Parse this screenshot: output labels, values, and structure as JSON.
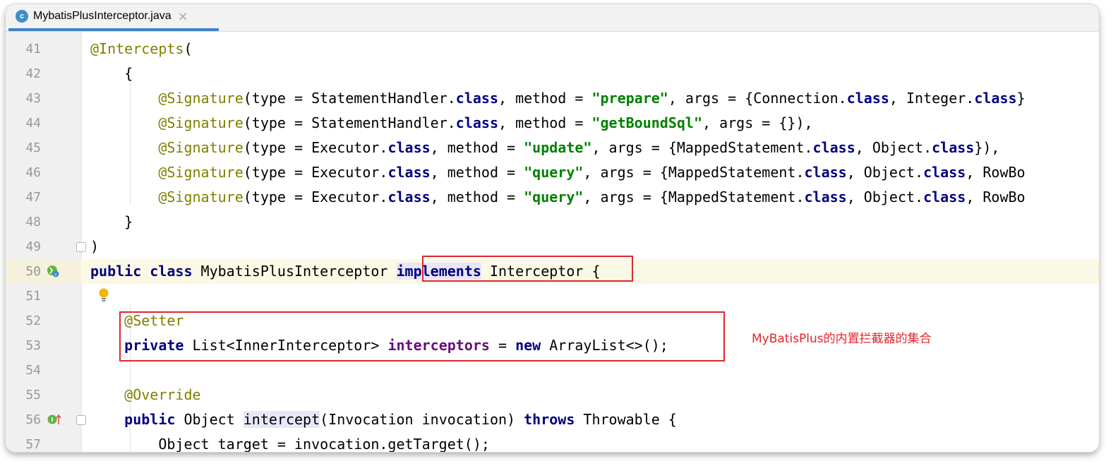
{
  "tab": {
    "icon_letter": "c",
    "filename": "MybatisPlusInterceptor.java",
    "close_glyph": "×"
  },
  "icons": {
    "tab_file": "java-class-icon",
    "line50": "implemented-class-icon",
    "line51": "intention-bulb-icon",
    "line56": "implementing-method-icon",
    "fold": "fold-marker-icon"
  },
  "colors": {
    "keyword": "#000080",
    "string": "#008000",
    "annotation": "#808000",
    "field": "#660e7a",
    "highlight_box": "#e0262c",
    "current_line": "#fcf8e6"
  },
  "lines": [
    {
      "num": "41",
      "a": "@Intercepts",
      "b": "("
    },
    {
      "num": "42",
      "indent": "    ",
      "b": "{"
    },
    {
      "num": "43",
      "indent": "        ",
      "a": "@Signature",
      "p1": "(type = StatementHandler.",
      "k1": "class",
      "p2": ", method = ",
      "s": "\"prepare\"",
      "p3": ", args = {Connection.",
      "k2": "class",
      "p4": ", Integer.",
      "k3": "class",
      "p5": "}"
    },
    {
      "num": "44",
      "indent": "        ",
      "a": "@Signature",
      "p1": "(type = StatementHandler.",
      "k1": "class",
      "p2": ", method = ",
      "s": "\"getBoundSql\"",
      "p3": ", args = {}),",
      "k2": "",
      "p4": "",
      "k3": "",
      "p5": ""
    },
    {
      "num": "45",
      "indent": "        ",
      "a": "@Signature",
      "p1": "(type = Executor.",
      "k1": "class",
      "p2": ", method = ",
      "s": "\"update\"",
      "p3": ", args = {MappedStatement.",
      "k2": "class",
      "p4": ", Object.",
      "k3": "class",
      "p5": "}),"
    },
    {
      "num": "46",
      "indent": "        ",
      "a": "@Signature",
      "p1": "(type = Executor.",
      "k1": "class",
      "p2": ", method = ",
      "s": "\"query\"",
      "p3": ", args = {MappedStatement.",
      "k2": "class",
      "p4": ", Object.",
      "k3": "class",
      "p5": ", RowBo"
    },
    {
      "num": "47",
      "indent": "        ",
      "a": "@Signature",
      "p1": "(type = Executor.",
      "k1": "class",
      "p2": ", method = ",
      "s": "\"query\"",
      "p3": ", args = {MappedStatement.",
      "k2": "class",
      "p4": ", Object.",
      "k3": "class",
      "p5": ", RowBo"
    },
    {
      "num": "48",
      "indent": "    ",
      "b": "}"
    },
    {
      "num": "49",
      "b": ")"
    },
    {
      "num": "50",
      "k1": "public",
      "p1": " ",
      "k2": "class",
      "p2": " MybatisPlusInterceptor ",
      "k3": "implements",
      "p3": " Interceptor",
      "p4": " {"
    },
    {
      "num": "51"
    },
    {
      "num": "52",
      "indent": "    ",
      "a": "@Setter"
    },
    {
      "num": "53",
      "indent": "    ",
      "k1": "private",
      "p1": " List<InnerInterceptor> ",
      "f": "interceptors",
      "p2": " = ",
      "k2": "new",
      "p3": " ArrayList<>();"
    },
    {
      "num": "54"
    },
    {
      "num": "55",
      "indent": "    ",
      "a": "@Override"
    },
    {
      "num": "56",
      "indent": "    ",
      "k1": "public",
      "p1": " Object ",
      "m": "intercept",
      "p2": "(Invocation invocation) ",
      "k2": "throws",
      "p3": " Throwable {"
    },
    {
      "num": "57",
      "indent": "        ",
      "p1": "Object target = invocation.getTarget();"
    }
  ],
  "annotation_note": "MyBatisPlus的内置拦截器的集合"
}
